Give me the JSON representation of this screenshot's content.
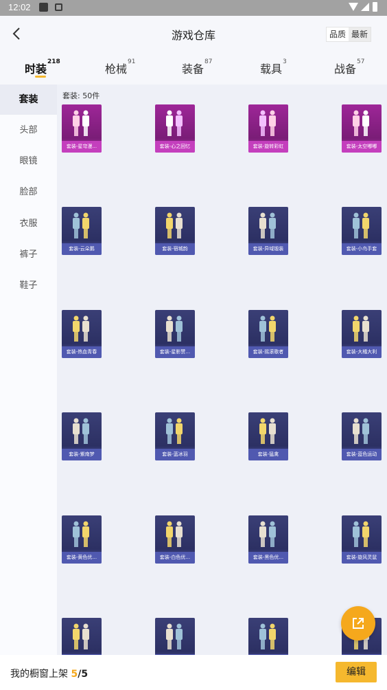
{
  "status_bar": {
    "time": "12:02"
  },
  "header": {
    "title": "游戏仓库",
    "sort_options": [
      "品质",
      "最新"
    ],
    "active_sort": 0
  },
  "tabs": [
    {
      "label": "时装",
      "count": "218"
    },
    {
      "label": "枪械",
      "count": "91"
    },
    {
      "label": "装备",
      "count": "87"
    },
    {
      "label": "载具",
      "count": "3"
    },
    {
      "label": "战备",
      "count": "57"
    }
  ],
  "active_tab": 0,
  "sidebar": {
    "items": [
      "套装",
      "头部",
      "眼镜",
      "脸部",
      "衣服",
      "裤子",
      "鞋子"
    ],
    "active": 0
  },
  "content": {
    "count_text": "套装: 50件",
    "items": [
      {
        "label": "套装-星穹漫...",
        "tier": "purple"
      },
      {
        "label": "套装-心之回忆",
        "tier": "purple"
      },
      {
        "label": "套装-旋转彩虹",
        "tier": "purple"
      },
      {
        "label": "套装-太空嘟嘟",
        "tier": "purple"
      },
      {
        "label": "套装-云朵鹅",
        "tier": "blue"
      },
      {
        "label": "套装-宿城韵",
        "tier": "blue"
      },
      {
        "label": "套装-异域锻装",
        "tier": "blue"
      },
      {
        "label": "套装-小鸟手套",
        "tier": "blue"
      },
      {
        "label": "套装-热血青春",
        "tier": "blue"
      },
      {
        "label": "套装-星影赞...",
        "tier": "blue"
      },
      {
        "label": "套装-摇滚歌者",
        "tier": "blue"
      },
      {
        "label": "套装-大橘大利",
        "tier": "blue"
      },
      {
        "label": "套装-紫南梦",
        "tier": "blue"
      },
      {
        "label": "套装-蓝冰羽",
        "tier": "blue"
      },
      {
        "label": "套装-猛禽",
        "tier": "blue"
      },
      {
        "label": "套装-蓝色运动",
        "tier": "blue"
      },
      {
        "label": "套装-黄色优...",
        "tier": "blue"
      },
      {
        "label": "套装-白色优...",
        "tier": "blue"
      },
      {
        "label": "套装-黑色优...",
        "tier": "blue"
      },
      {
        "label": "套装-旋风灵鼠",
        "tier": "blue"
      },
      {
        "label": "",
        "tier": "blue"
      },
      {
        "label": "",
        "tier": "blue"
      },
      {
        "label": "",
        "tier": "blue"
      },
      {
        "label": "",
        "tier": "blue"
      }
    ]
  },
  "bottom_bar": {
    "label": "我的橱窗上架",
    "current": "5",
    "total": "/5",
    "edit_label": "编辑"
  },
  "colors": {
    "accent": "#f5b82e",
    "purple_tier": "#c43fbd",
    "blue_tier": "#5059b0"
  },
  "icons": {
    "back": "back-chevron-icon",
    "fab": "share-export-icon"
  }
}
